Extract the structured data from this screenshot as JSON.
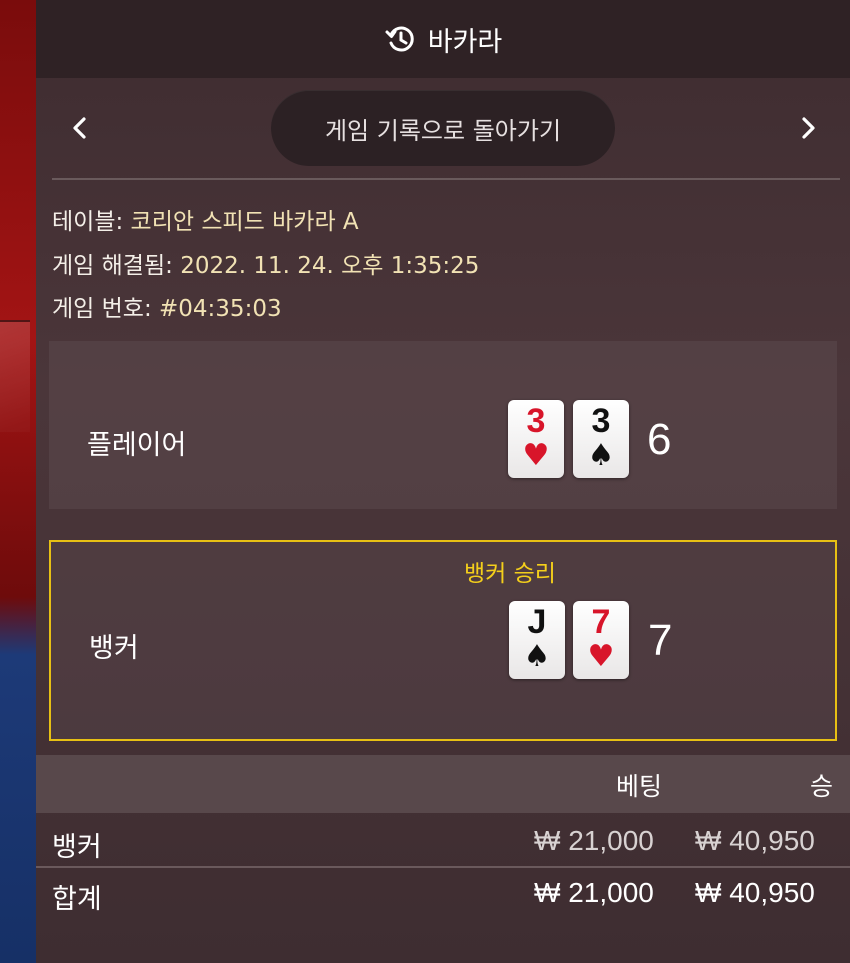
{
  "header": {
    "title": "바카라",
    "icon": "history-icon"
  },
  "nav": {
    "back_label": "게임 기록으로 돌아가기",
    "prev_icon": "chevron-left-icon",
    "next_icon": "chevron-right-icon"
  },
  "info": {
    "table_label": "테이블:",
    "table_value": "코리안 스피드 바카라 A",
    "resolved_label": "게임 해결됨:",
    "resolved_value": "2022. 11. 24. 오후 1:35:25",
    "number_label": "게임 번호:",
    "number_value": "#04:35:03"
  },
  "player": {
    "name": "플레이어",
    "cards": [
      {
        "rank": "3",
        "suit": "♥"
      },
      {
        "rank": "3",
        "suit": "♠"
      }
    ],
    "score": "6"
  },
  "banker": {
    "name": "뱅커",
    "win_label": "뱅커 승리",
    "cards": [
      {
        "rank": "J",
        "suit": "♠"
      },
      {
        "rank": "7",
        "suit": "♥"
      }
    ],
    "score": "7"
  },
  "table": {
    "col_bet": "베팅",
    "col_win": "승",
    "rows": [
      {
        "label": "뱅커",
        "bet": "₩ 21,000",
        "win": "₩ 40,950"
      },
      {
        "label": "합계",
        "bet": "₩ 21,000",
        "win": "₩ 40,950"
      }
    ]
  },
  "colors": {
    "win_border": "#e7c014",
    "heart": "#d8152a",
    "spade": "#111111"
  }
}
